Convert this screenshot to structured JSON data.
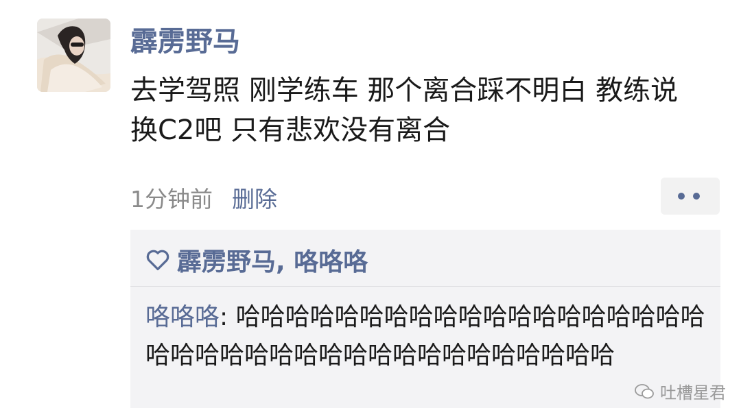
{
  "post": {
    "author": "霹雳野马",
    "text": "去学驾照 刚学练车 那个离合踩不明白 教练说 换C2吧 只有悲欢没有离合",
    "time": "1分钟前",
    "delete_label": "删除"
  },
  "likes": {
    "names": "霹雳野马, 咯咯咯"
  },
  "comments": [
    {
      "author": "咯咯咯",
      "separator": ": ",
      "text": "哈哈哈哈哈哈哈哈哈哈哈哈哈哈哈哈哈哈哈哈哈哈哈哈哈哈哈哈哈哈哈哈哈哈哈哈哈哈"
    }
  ],
  "watermark": {
    "text": "吐槽星君"
  },
  "icons": {
    "like": "heart-outline-icon",
    "more": "more-dots-icon",
    "watermark": "wechat-icon"
  },
  "colors": {
    "link": "#586b95",
    "text": "#1a1a1a",
    "meta": "#8a8a8a",
    "comment_bg": "#f3f3f5"
  }
}
